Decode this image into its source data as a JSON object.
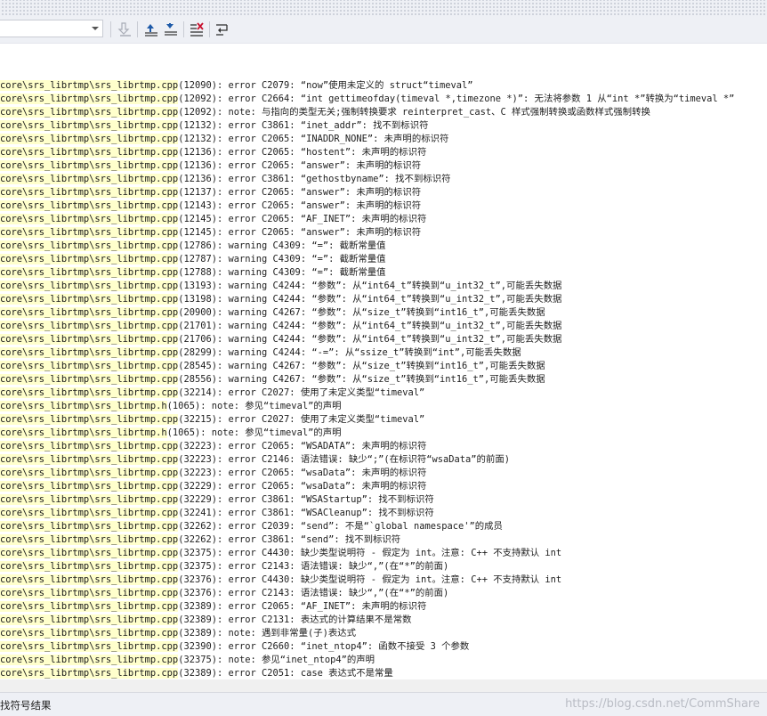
{
  "colors": {
    "toolbar_bg": "#eef0f5",
    "path_highlight": "#ffffcc",
    "text": "#1e1e1e"
  },
  "toolbar": {
    "combo_value": "",
    "buttons": [
      {
        "icon": "clear-icon"
      },
      {
        "icon": "previous-message-icon"
      },
      {
        "icon": "next-message-icon"
      },
      {
        "icon": "clear-all-icon"
      },
      {
        "icon": "word-wrap-icon"
      }
    ]
  },
  "output": {
    "lines": [
      {
        "path": "core\\srs_librtmp\\srs_librtmp.cpp",
        "msg": "(12090): error C2079: “now”使用未定义的 struct“timeval”"
      },
      {
        "path": "core\\srs_librtmp\\srs_librtmp.cpp",
        "msg": "(12092): error C2664: “int gettimeofday(timeval *,timezone *)”: 无法将参数 1 从“int *”转换为“timeval *”"
      },
      {
        "path": "core\\srs_librtmp\\srs_librtmp.cpp",
        "msg": "(12092): note: 与指向的类型无关;强制转换要求 reinterpret_cast、C 样式强制转换或函数样式强制转换"
      },
      {
        "path": "core\\srs_librtmp\\srs_librtmp.cpp",
        "msg": "(12132): error C3861: “inet_addr”: 找不到标识符"
      },
      {
        "path": "core\\srs_librtmp\\srs_librtmp.cpp",
        "msg": "(12132): error C2065: “INADDR_NONE”: 未声明的标识符"
      },
      {
        "path": "core\\srs_librtmp\\srs_librtmp.cpp",
        "msg": "(12136): error C2065: “hostent”: 未声明的标识符"
      },
      {
        "path": "core\\srs_librtmp\\srs_librtmp.cpp",
        "msg": "(12136): error C2065: “answer”: 未声明的标识符"
      },
      {
        "path": "core\\srs_librtmp\\srs_librtmp.cpp",
        "msg": "(12136): error C3861: “gethostbyname”: 找不到标识符"
      },
      {
        "path": "core\\srs_librtmp\\srs_librtmp.cpp",
        "msg": "(12137): error C2065: “answer”: 未声明的标识符"
      },
      {
        "path": "core\\srs_librtmp\\srs_librtmp.cpp",
        "msg": "(12143): error C2065: “answer”: 未声明的标识符"
      },
      {
        "path": "core\\srs_librtmp\\srs_librtmp.cpp",
        "msg": "(12145): error C2065: “AF_INET”: 未声明的标识符"
      },
      {
        "path": "core\\srs_librtmp\\srs_librtmp.cpp",
        "msg": "(12145): error C2065: “answer”: 未声明的标识符"
      },
      {
        "path": "core\\srs_librtmp\\srs_librtmp.cpp",
        "msg": "(12786): warning C4309: “=”: 截断常量值"
      },
      {
        "path": "core\\srs_librtmp\\srs_librtmp.cpp",
        "msg": "(12787): warning C4309: “=”: 截断常量值"
      },
      {
        "path": "core\\srs_librtmp\\srs_librtmp.cpp",
        "msg": "(12788): warning C4309: “=”: 截断常量值"
      },
      {
        "path": "core\\srs_librtmp\\srs_librtmp.cpp",
        "msg": "(13193): warning C4244: “参数”: 从“int64_t”转换到“u_int32_t”,可能丢失数据"
      },
      {
        "path": "core\\srs_librtmp\\srs_librtmp.cpp",
        "msg": "(13198): warning C4244: “参数”: 从“int64_t”转换到“u_int32_t”,可能丢失数据"
      },
      {
        "path": "core\\srs_librtmp\\srs_librtmp.cpp",
        "msg": "(20900): warning C4267: “参数”: 从“size_t”转换到“int16_t”,可能丢失数据"
      },
      {
        "path": "core\\srs_librtmp\\srs_librtmp.cpp",
        "msg": "(21701): warning C4244: “参数”: 从“int64_t”转换到“u_int32_t”,可能丢失数据"
      },
      {
        "path": "core\\srs_librtmp\\srs_librtmp.cpp",
        "msg": "(21706): warning C4244: “参数”: 从“int64_t”转换到“u_int32_t”,可能丢失数据"
      },
      {
        "path": "core\\srs_librtmp\\srs_librtmp.cpp",
        "msg": "(28299): warning C4244: “-=”: 从“ssize_t”转换到“int”,可能丢失数据"
      },
      {
        "path": "core\\srs_librtmp\\srs_librtmp.cpp",
        "msg": "(28545): warning C4267: “参数”: 从“size_t”转换到“int16_t”,可能丢失数据"
      },
      {
        "path": "core\\srs_librtmp\\srs_librtmp.cpp",
        "msg": "(28556): warning C4267: “参数”: 从“size_t”转换到“int16_t”,可能丢失数据"
      },
      {
        "path": "core\\srs_librtmp\\srs_librtmp.cpp",
        "msg": "(32214): error C2027: 使用了未定义类型“timeval”"
      },
      {
        "path": "core\\srs_librtmp\\srs_librtmp.h",
        "msg": "(1065): note: 参见“timeval”的声明"
      },
      {
        "path": "core\\srs_librtmp\\srs_librtmp.cpp",
        "msg": "(32215): error C2027: 使用了未定义类型“timeval”"
      },
      {
        "path": "core\\srs_librtmp\\srs_librtmp.h",
        "msg": "(1065): note: 参见“timeval”的声明"
      },
      {
        "path": "core\\srs_librtmp\\srs_librtmp.cpp",
        "msg": "(32223): error C2065: “WSADATA”: 未声明的标识符"
      },
      {
        "path": "core\\srs_librtmp\\srs_librtmp.cpp",
        "msg": "(32223): error C2146: 语法错误: 缺少“;”(在标识符“wsaData”的前面)"
      },
      {
        "path": "core\\srs_librtmp\\srs_librtmp.cpp",
        "msg": "(32223): error C2065: “wsaData”: 未声明的标识符"
      },
      {
        "path": "core\\srs_librtmp\\srs_librtmp.cpp",
        "msg": "(32229): error C2065: “wsaData”: 未声明的标识符"
      },
      {
        "path": "core\\srs_librtmp\\srs_librtmp.cpp",
        "msg": "(32229): error C3861: “WSAStartup”: 找不到标识符"
      },
      {
        "path": "core\\srs_librtmp\\srs_librtmp.cpp",
        "msg": "(32241): error C3861: “WSACleanup”: 找不到标识符"
      },
      {
        "path": "core\\srs_librtmp\\srs_librtmp.cpp",
        "msg": "(32262): error C2039: “send”: 不是“`global namespace'”的成员"
      },
      {
        "path": "core\\srs_librtmp\\srs_librtmp.cpp",
        "msg": "(32262): error C3861: “send”: 找不到标识符"
      },
      {
        "path": "core\\srs_librtmp\\srs_librtmp.cpp",
        "msg": "(32375): error C4430: 缺少类型说明符 - 假定为 int。注意: C++ 不支持默认 int"
      },
      {
        "path": "core\\srs_librtmp\\srs_librtmp.cpp",
        "msg": "(32375): error C2143: 语法错误: 缺少“,”(在“*”的前面)"
      },
      {
        "path": "core\\srs_librtmp\\srs_librtmp.cpp",
        "msg": "(32376): error C4430: 缺少类型说明符 - 假定为 int。注意: C++ 不支持默认 int"
      },
      {
        "path": "core\\srs_librtmp\\srs_librtmp.cpp",
        "msg": "(32376): error C2143: 语法错误: 缺少“,”(在“*”的前面)"
      },
      {
        "path": "core\\srs_librtmp\\srs_librtmp.cpp",
        "msg": "(32389): error C2065: “AF_INET”: 未声明的标识符"
      },
      {
        "path": "core\\srs_librtmp\\srs_librtmp.cpp",
        "msg": "(32389): error C2131: 表达式的计算结果不是常数"
      },
      {
        "path": "core\\srs_librtmp\\srs_librtmp.cpp",
        "msg": "(32389): note: 遇到非常量(子)表达式"
      },
      {
        "path": "core\\srs_librtmp\\srs_librtmp.cpp",
        "msg": "(32390): error C2660: “inet_ntop4”: 函数不接受 3 个参数"
      },
      {
        "path": "core\\srs_librtmp\\srs_librtmp.cpp",
        "msg": "(32375): note: 参见“inet_ntop4”的声明"
      },
      {
        "path": "core\\srs_librtmp\\srs_librtmp.cpp",
        "msg": "(32389): error C2051: case 表达式不是常量"
      }
    ]
  },
  "statusbar": {
    "tab_label": "找符号结果",
    "watermark": "https://blog.csdn.net/CommShare"
  }
}
